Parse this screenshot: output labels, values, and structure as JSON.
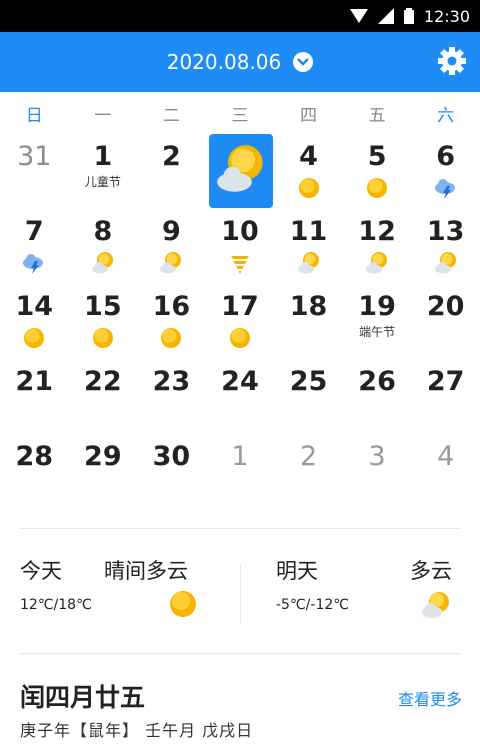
{
  "status": {
    "time": "12:30"
  },
  "header": {
    "date": "2020.08.06"
  },
  "weekdays": [
    "日",
    "一",
    "二",
    "三",
    "四",
    "五",
    "六"
  ],
  "calendar": [
    [
      {
        "d": "31",
        "style": "gray"
      },
      {
        "d": "1",
        "sub": "儿童节"
      },
      {
        "d": "2"
      },
      {
        "d": "3",
        "selected": true,
        "icon": "cloud-sun"
      },
      {
        "d": "4",
        "icon": "sun"
      },
      {
        "d": "5",
        "icon": "sun"
      },
      {
        "d": "6",
        "icon": "storm"
      }
    ],
    [
      {
        "d": "7",
        "icon": "storm"
      },
      {
        "d": "8",
        "icon": "cloud-sun"
      },
      {
        "d": "9",
        "icon": "cloud-sun"
      },
      {
        "d": "10",
        "icon": "tornado"
      },
      {
        "d": "11",
        "icon": "cloud-sun"
      },
      {
        "d": "12",
        "icon": "cloud-sun"
      },
      {
        "d": "13",
        "icon": "cloud-sun"
      }
    ],
    [
      {
        "d": "14",
        "icon": "sun"
      },
      {
        "d": "15",
        "icon": "sun"
      },
      {
        "d": "16",
        "icon": "sun"
      },
      {
        "d": "17",
        "icon": "sun"
      },
      {
        "d": "18"
      },
      {
        "d": "19",
        "sub": "端午节"
      },
      {
        "d": "20"
      }
    ],
    [
      {
        "d": "21"
      },
      {
        "d": "22"
      },
      {
        "d": "23"
      },
      {
        "d": "24"
      },
      {
        "d": "25"
      },
      {
        "d": "26"
      },
      {
        "d": "27"
      }
    ],
    [
      {
        "d": "28"
      },
      {
        "d": "29"
      },
      {
        "d": "30"
      },
      {
        "d": "1",
        "style": "faint"
      },
      {
        "d": "2",
        "style": "faint"
      },
      {
        "d": "3",
        "style": "faint"
      },
      {
        "d": "4",
        "style": "faint"
      }
    ]
  ],
  "today": {
    "label": "今天",
    "weather": "晴间多云",
    "temp": "12℃/18℃",
    "icon": "sun"
  },
  "tomorrow": {
    "label": "明天",
    "weather": "多云",
    "temp": "-5℃/-12℃",
    "icon": "cloud-sun"
  },
  "lunar": {
    "date": "闰四月廿五",
    "more": "查看更多",
    "ganzhi": "庚子年【鼠年】 壬午月 戊戌日"
  }
}
